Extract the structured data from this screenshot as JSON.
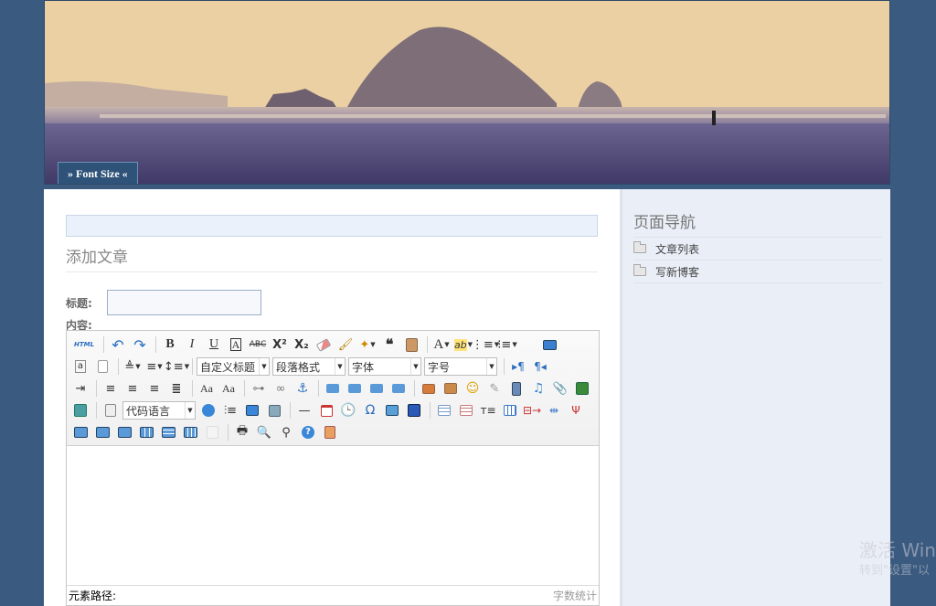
{
  "header": {
    "font_size_label": "» Font Size «"
  },
  "main": {
    "page_title": "添加文章",
    "title_label": "标题:",
    "content_label": "内容:"
  },
  "editor": {
    "combos": {
      "custom_heading": "自定义标题",
      "paragraph_format": "段落格式",
      "font_family": "字体",
      "font_size": "字号",
      "code_language": "代码语言"
    },
    "status_path_label": "元素路径:",
    "word_count_label": "字数统计"
  },
  "sidebar": {
    "title": "页面导航",
    "items": [
      {
        "label": "文章列表"
      },
      {
        "label": "写新博客"
      }
    ]
  },
  "watermark": {
    "line1": "激活 Win",
    "line2": "转到\"设置\"以"
  }
}
